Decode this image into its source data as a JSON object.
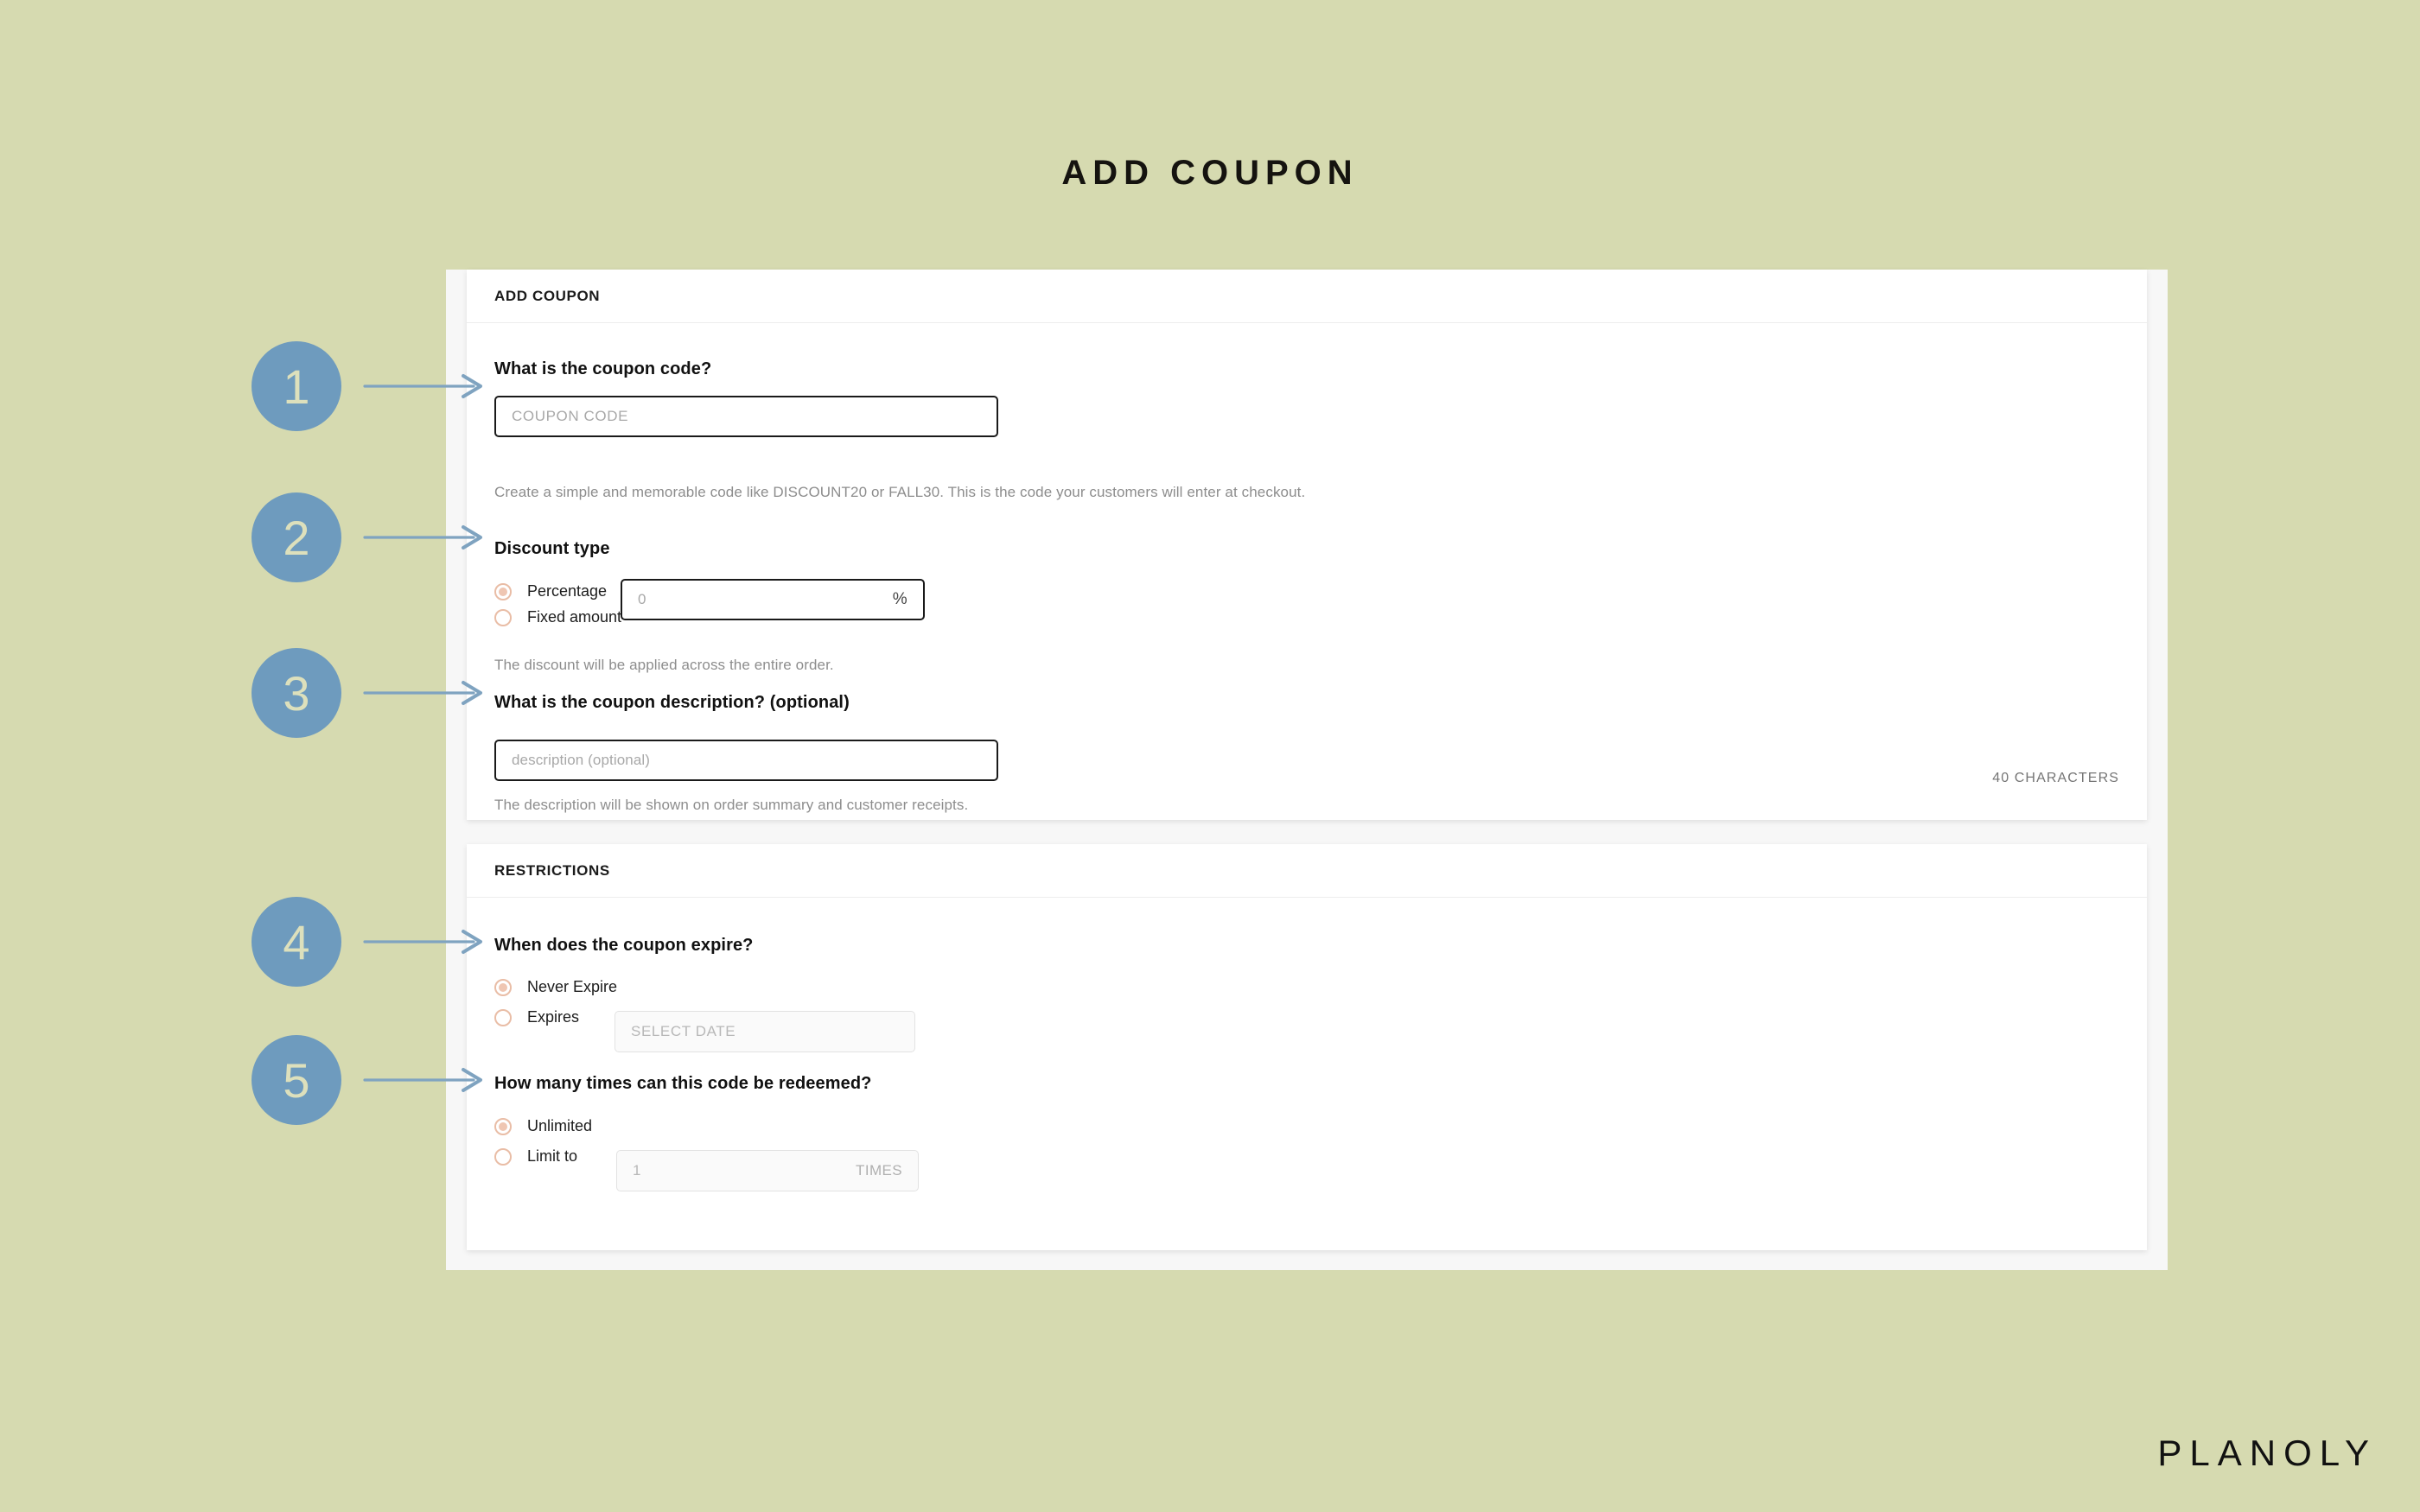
{
  "page": {
    "title": "ADD COUPON",
    "brand": "PLANOLY",
    "bg_color": "#D6DAB0",
    "accent_blue": "#6E9BBE",
    "accent_peach": "#E9BDA6"
  },
  "cards": {
    "main": {
      "header": "ADD COUPON"
    },
    "restrictions": {
      "header": "RESTRICTIONS"
    }
  },
  "fields": {
    "coupon_code": {
      "label": "What is the coupon code?",
      "placeholder": "COUPON CODE",
      "helper": "Create a simple and memorable code like DISCOUNT20 or FALL30. This is the code your customers will enter at checkout."
    },
    "discount_type": {
      "label": "Discount type",
      "options": [
        {
          "label": "Percentage",
          "selected": true
        },
        {
          "label": "Fixed amount",
          "selected": false
        }
      ],
      "amount_placeholder": "0",
      "amount_suffix": "%",
      "helper": "The discount will be applied across the entire order."
    },
    "description": {
      "label": "What is the coupon description? (optional)",
      "placeholder": "description (optional)",
      "counter": "40 CHARACTERS",
      "helper": "The description will be shown on order summary and customer receipts."
    },
    "expiry": {
      "label": "When does the coupon expire?",
      "options": [
        {
          "label": "Never Expire",
          "selected": true
        },
        {
          "label": "Expires",
          "selected": false
        }
      ],
      "date_placeholder": "SELECT DATE"
    },
    "redemption": {
      "label": "How many times can this code be redeemed?",
      "options": [
        {
          "label": "Unlimited",
          "selected": true
        },
        {
          "label": "Limit to",
          "selected": false
        }
      ],
      "limit_placeholder": "1",
      "limit_suffix": "TIMES"
    }
  },
  "callouts": [
    {
      "number": "1"
    },
    {
      "number": "2"
    },
    {
      "number": "3"
    },
    {
      "number": "4"
    },
    {
      "number": "5"
    }
  ]
}
